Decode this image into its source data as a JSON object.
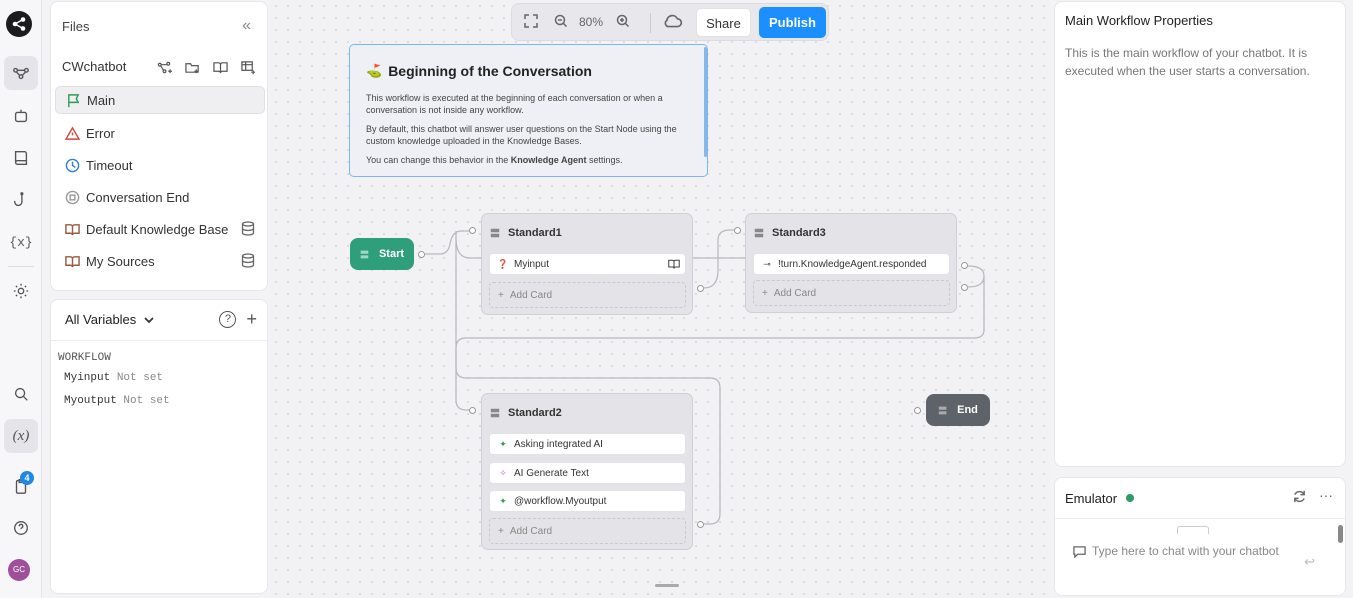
{
  "rail": {
    "items": [
      "flow-icon",
      "bot-icon",
      "book-icon",
      "hook-icon",
      "variable-braces-icon",
      "settings-icon",
      "search-icon",
      "function-icon",
      "clipboard-icon",
      "help-icon"
    ],
    "notification_count": "4",
    "avatar_initials": "GC"
  },
  "files": {
    "title": "Files",
    "project_name": "CWchatbot",
    "items": [
      {
        "label": "Main",
        "icon": "flag-icon",
        "color": "#2e9b5a",
        "selected": true
      },
      {
        "label": "Error",
        "icon": "warning-icon",
        "color": "#d9443f"
      },
      {
        "label": "Timeout",
        "icon": "clock-icon",
        "color": "#2f7fd1"
      },
      {
        "label": "Conversation End",
        "icon": "stop-circle-icon",
        "color": "#999999"
      },
      {
        "label": "Default Knowledge Base",
        "icon": "book-icon",
        "color": "#9a5a3c"
      },
      {
        "label": "My Sources",
        "icon": "book-icon",
        "color": "#9a5a3c"
      }
    ]
  },
  "variables": {
    "title": "All Variables",
    "section": "WORKFLOW",
    "items": [
      {
        "name": "Myinput",
        "value": "Not set"
      },
      {
        "name": "Myoutput",
        "value": "Not set"
      }
    ]
  },
  "toolbar": {
    "zoom": "80%",
    "share_label": "Share",
    "publish_label": "Publish",
    "publish_color": "#1b8fff"
  },
  "intro": {
    "title": "Beginning of the Conversation",
    "p1": "This workflow is executed at the beginning of each conversation or when a conversation is not inside any workflow.",
    "p2": "By default, this chatbot will answer user questions on the Start Node using the custom knowledge uploaded in the Knowledge Bases.",
    "p3_prefix": "You can change this behavior in the ",
    "p3_bold": "Knowledge Agent",
    "p3_suffix": " settings."
  },
  "nodes": {
    "start": "Start",
    "end": "End",
    "standard1": {
      "title": "Standard1",
      "cards": [
        "Myinput"
      ],
      "add_card": "Add Card"
    },
    "standard3": {
      "title": "Standard3",
      "cards": [
        "!turn.KnowledgeAgent.responded"
      ],
      "add_card": "Add Card"
    },
    "standard2": {
      "title": "Standard2",
      "cards": [
        "Asking integrated AI",
        "AI Generate Text",
        "@workflow.Myoutput"
      ],
      "add_card": "Add Card"
    }
  },
  "properties": {
    "title": "Main Workflow Properties",
    "description": "This is the main workflow of your chatbot. It is executed when the user starts a conversation."
  },
  "emulator": {
    "title": "Emulator",
    "status_color": "#2a9d5f",
    "placeholder": "Type here to chat with your chatbot"
  }
}
